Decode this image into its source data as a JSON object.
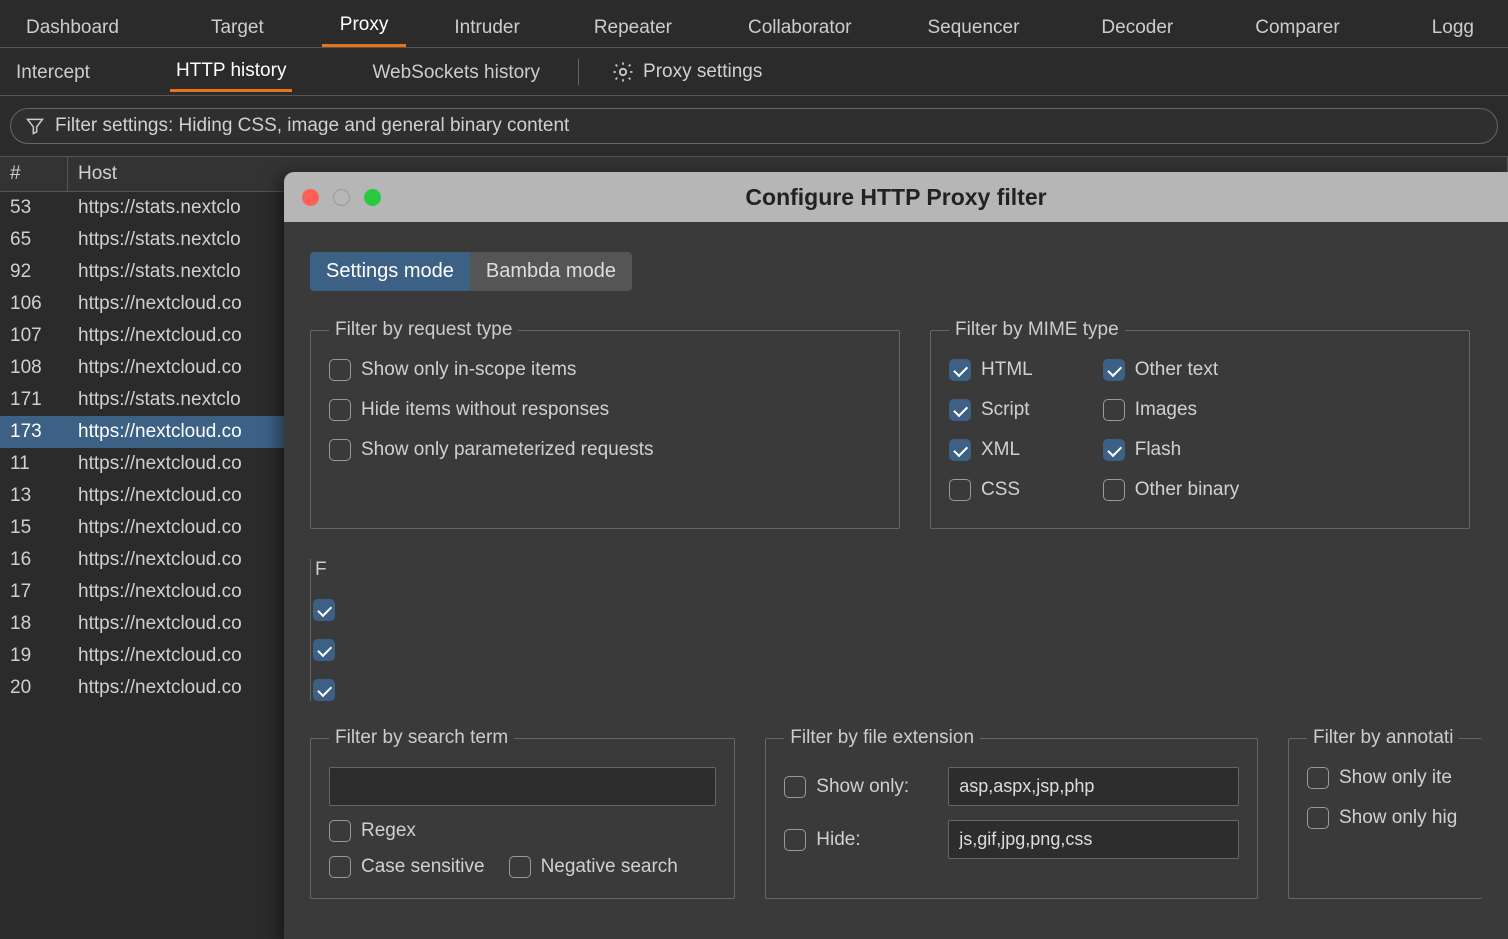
{
  "main_tabs": {
    "dashboard": "Dashboard",
    "target": "Target",
    "proxy": "Proxy",
    "intruder": "Intruder",
    "repeater": "Repeater",
    "collaborator": "Collaborator",
    "sequencer": "Sequencer",
    "decoder": "Decoder",
    "comparer": "Comparer",
    "logger": "Logg"
  },
  "sub_tabs": {
    "intercept": "Intercept",
    "http_history": "HTTP history",
    "ws_history": "WebSockets history",
    "proxy_settings": "Proxy settings"
  },
  "filter_bar": "Filter settings: Hiding CSS, image and general binary content",
  "columns": {
    "num": "#",
    "host": "Host"
  },
  "rows": [
    {
      "num": "53",
      "host": "https://stats.nextclo"
    },
    {
      "num": "65",
      "host": "https://stats.nextclo"
    },
    {
      "num": "92",
      "host": "https://stats.nextclo"
    },
    {
      "num": "106",
      "host": "https://nextcloud.co"
    },
    {
      "num": "107",
      "host": "https://nextcloud.co"
    },
    {
      "num": "108",
      "host": "https://nextcloud.co"
    },
    {
      "num": "171",
      "host": "https://stats.nextclo"
    },
    {
      "num": "173",
      "host": "https://nextcloud.co"
    },
    {
      "num": "11",
      "host": "https://nextcloud.co"
    },
    {
      "num": "13",
      "host": "https://nextcloud.co"
    },
    {
      "num": "15",
      "host": "https://nextcloud.co"
    },
    {
      "num": "16",
      "host": "https://nextcloud.co"
    },
    {
      "num": "17",
      "host": "https://nextcloud.co"
    },
    {
      "num": "18",
      "host": "https://nextcloud.co"
    },
    {
      "num": "19",
      "host": "https://nextcloud.co"
    },
    {
      "num": "20",
      "host": "https://nextcloud.co"
    }
  ],
  "selected_row_index": 7,
  "dialog": {
    "title": "Configure HTTP Proxy filter",
    "mode": {
      "settings": "Settings mode",
      "bambda": "Bambda mode"
    },
    "groups": {
      "request_type": {
        "legend": "Filter by request type",
        "in_scope": "Show only in-scope items",
        "hide_noresp": "Hide items without responses",
        "param_only": "Show only parameterized requests"
      },
      "mime": {
        "legend": "Filter by MIME type",
        "html": "HTML",
        "script": "Script",
        "xml": "XML",
        "css": "CSS",
        "other_text": "Other text",
        "images": "Images",
        "flash": "Flash",
        "other_binary": "Other binary"
      },
      "right_clipped": {
        "legend": "F"
      },
      "search": {
        "legend": "Filter by search term",
        "value": "",
        "regex": "Regex",
        "case_sensitive": "Case sensitive",
        "negative": "Negative search"
      },
      "ext": {
        "legend": "Filter by file extension",
        "show_only_label": "Show only:",
        "show_only_value": "asp,aspx,jsp,php",
        "hide_label": "Hide:",
        "hide_value": "js,gif,jpg,png,css"
      },
      "annotation": {
        "legend": "Filter by annotati",
        "show_only_items": "Show only ite",
        "show_only_high": "Show only hig"
      }
    }
  }
}
